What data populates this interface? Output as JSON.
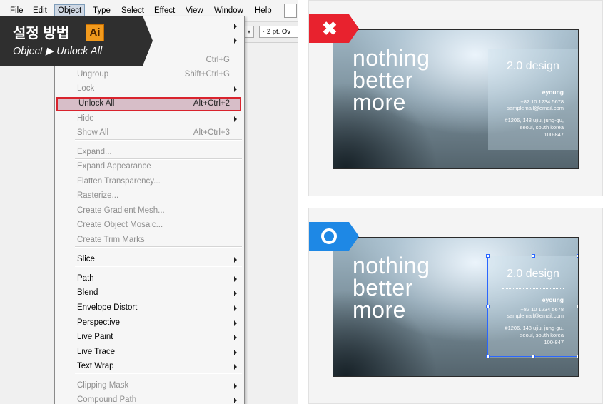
{
  "menubar": {
    "items": [
      "File",
      "Edit",
      "Object",
      "Type",
      "Select",
      "Effect",
      "View",
      "Window",
      "Help"
    ],
    "active": "Object"
  },
  "toolbar": {
    "stroke_value": "2 pt. Ov"
  },
  "badge": {
    "title": "설정 방법",
    "app_icon": "Ai",
    "path": "Object ▶ Unlock All"
  },
  "menu": {
    "items": [
      {
        "label": "",
        "shortcut": "",
        "submenu": true
      },
      {
        "label": "",
        "shortcut": "",
        "submenu": true
      },
      {
        "label": "",
        "shortcut": "Ctrl+G",
        "submenu": false
      },
      {
        "label": "Ungroup",
        "shortcut": "Shift+Ctrl+G",
        "submenu": false
      },
      {
        "label": "Lock",
        "shortcut": "",
        "submenu": true
      },
      {
        "label": "Unlock All",
        "shortcut": "Alt+Ctrl+2",
        "submenu": false
      },
      {
        "label": "Hide",
        "shortcut": "",
        "submenu": true
      },
      {
        "label": "Show All",
        "shortcut": "Alt+Ctrl+3",
        "submenu": false
      },
      {
        "label": "Expand...",
        "shortcut": "",
        "submenu": false
      },
      {
        "label": "Expand Appearance",
        "shortcut": "",
        "submenu": false
      },
      {
        "label": "Flatten Transparency...",
        "shortcut": "",
        "submenu": false
      },
      {
        "label": "Rasterize...",
        "shortcut": "",
        "submenu": false
      },
      {
        "label": "Create Gradient Mesh...",
        "shortcut": "",
        "submenu": false
      },
      {
        "label": "Create Object Mosaic...",
        "shortcut": "",
        "submenu": false
      },
      {
        "label": "Create Trim Marks",
        "shortcut": "",
        "submenu": false
      },
      {
        "label": "Slice",
        "shortcut": "",
        "submenu": true
      },
      {
        "label": "Path",
        "shortcut": "",
        "submenu": true
      },
      {
        "label": "Blend",
        "shortcut": "",
        "submenu": true
      },
      {
        "label": "Envelope Distort",
        "shortcut": "",
        "submenu": true
      },
      {
        "label": "Perspective",
        "shortcut": "",
        "submenu": true
      },
      {
        "label": "Live Paint",
        "shortcut": "",
        "submenu": true
      },
      {
        "label": "Live Trace",
        "shortcut": "",
        "submenu": true
      },
      {
        "label": "Text Wrap",
        "shortcut": "",
        "submenu": true
      },
      {
        "label": "Clipping Mask",
        "shortcut": "",
        "submenu": true
      },
      {
        "label": "Compound Path",
        "shortcut": "",
        "submenu": true
      }
    ],
    "highlighted": "Unlock All"
  },
  "examples": {
    "wrong": {
      "mark": "✖",
      "color": "#e8222e"
    },
    "right": {
      "color": "#1e88e5"
    }
  },
  "card": {
    "headline": [
      "nothing",
      "better",
      "more"
    ],
    "brand": "2.0 design",
    "name": "eyoung",
    "phone": "+82 10 1234 5678",
    "email": "samplemail@email.com",
    "address": [
      "#1206, 148 ujiu, jung-gu,",
      "seoul, south korea",
      "100-847"
    ]
  },
  "colors": {
    "highlight_border": "#d9232d",
    "highlight_bg": "#d7bec8",
    "selection": "#2a66ff",
    "ai_orange": "#f29a1d"
  }
}
